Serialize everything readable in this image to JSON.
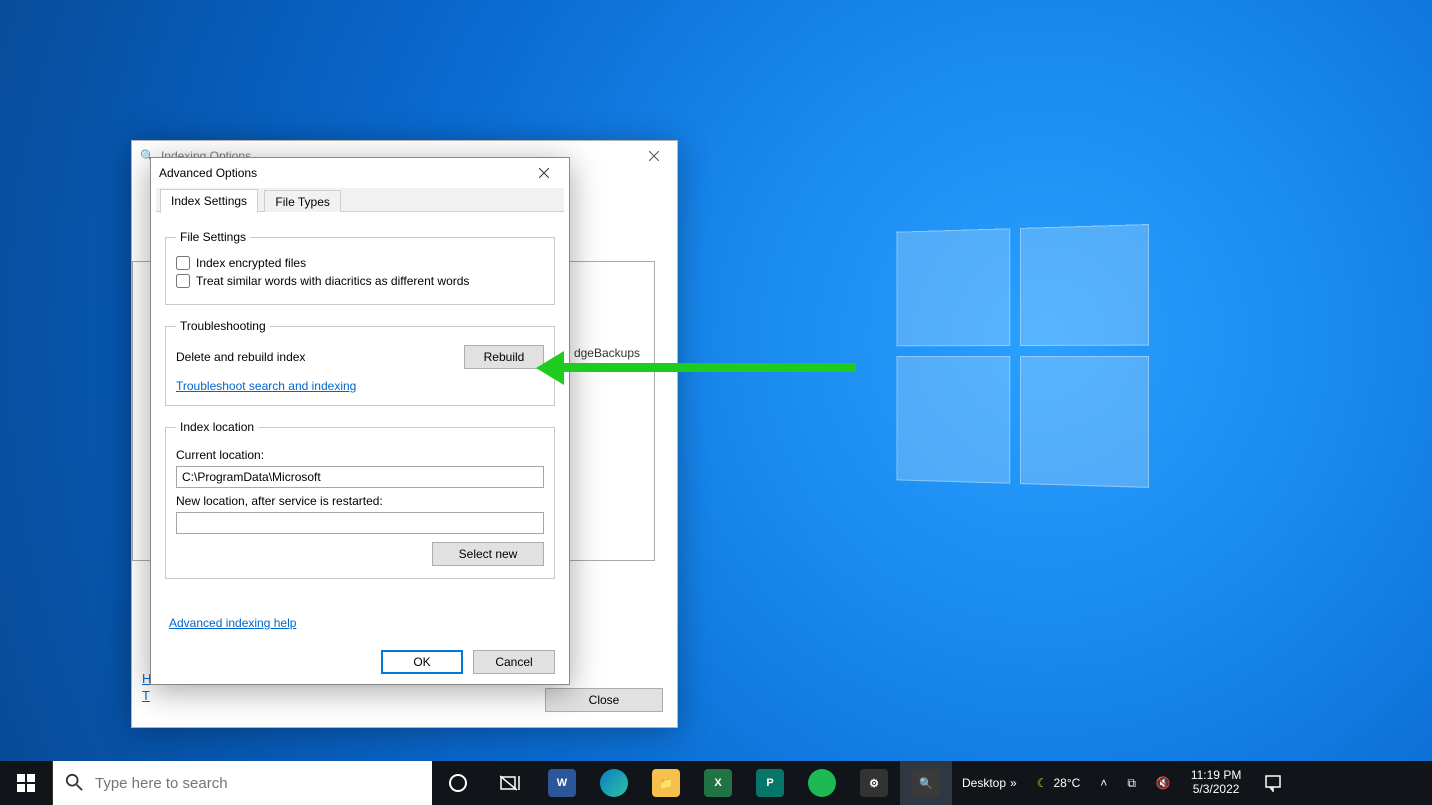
{
  "parent_window": {
    "title": "Indexing Options",
    "trunc": "I",
    "list_visible_text": "dgeBackups",
    "help_cut_h": "H",
    "help_cut_t": "T",
    "close_label": "Close"
  },
  "dialog": {
    "title": "Advanced Options",
    "tabs": {
      "settings": "Index Settings",
      "filetypes": "File Types"
    },
    "file_settings": {
      "legend": "File Settings",
      "opt1": "Index encrypted files",
      "opt2": "Treat similar words with diacritics as different words"
    },
    "troubleshooting": {
      "legend": "Troubleshooting",
      "delete_label": "Delete and rebuild index",
      "rebuild_label": "Rebuild",
      "search_link": "Troubleshoot search and indexing"
    },
    "index_location": {
      "legend": "Index location",
      "current_label": "Current location:",
      "current_value": "C:\\ProgramData\\Microsoft",
      "new_label": "New location, after service is restarted:",
      "new_value": "",
      "select_new_label": "Select new"
    },
    "adv_help": "Advanced indexing help",
    "ok": "OK",
    "cancel": "Cancel"
  },
  "taskbar": {
    "search_placeholder": "Type here to search",
    "desktop_label": "Desktop",
    "weather_temp": "28°C",
    "time": "11:19 PM",
    "date": "5/3/2022"
  }
}
